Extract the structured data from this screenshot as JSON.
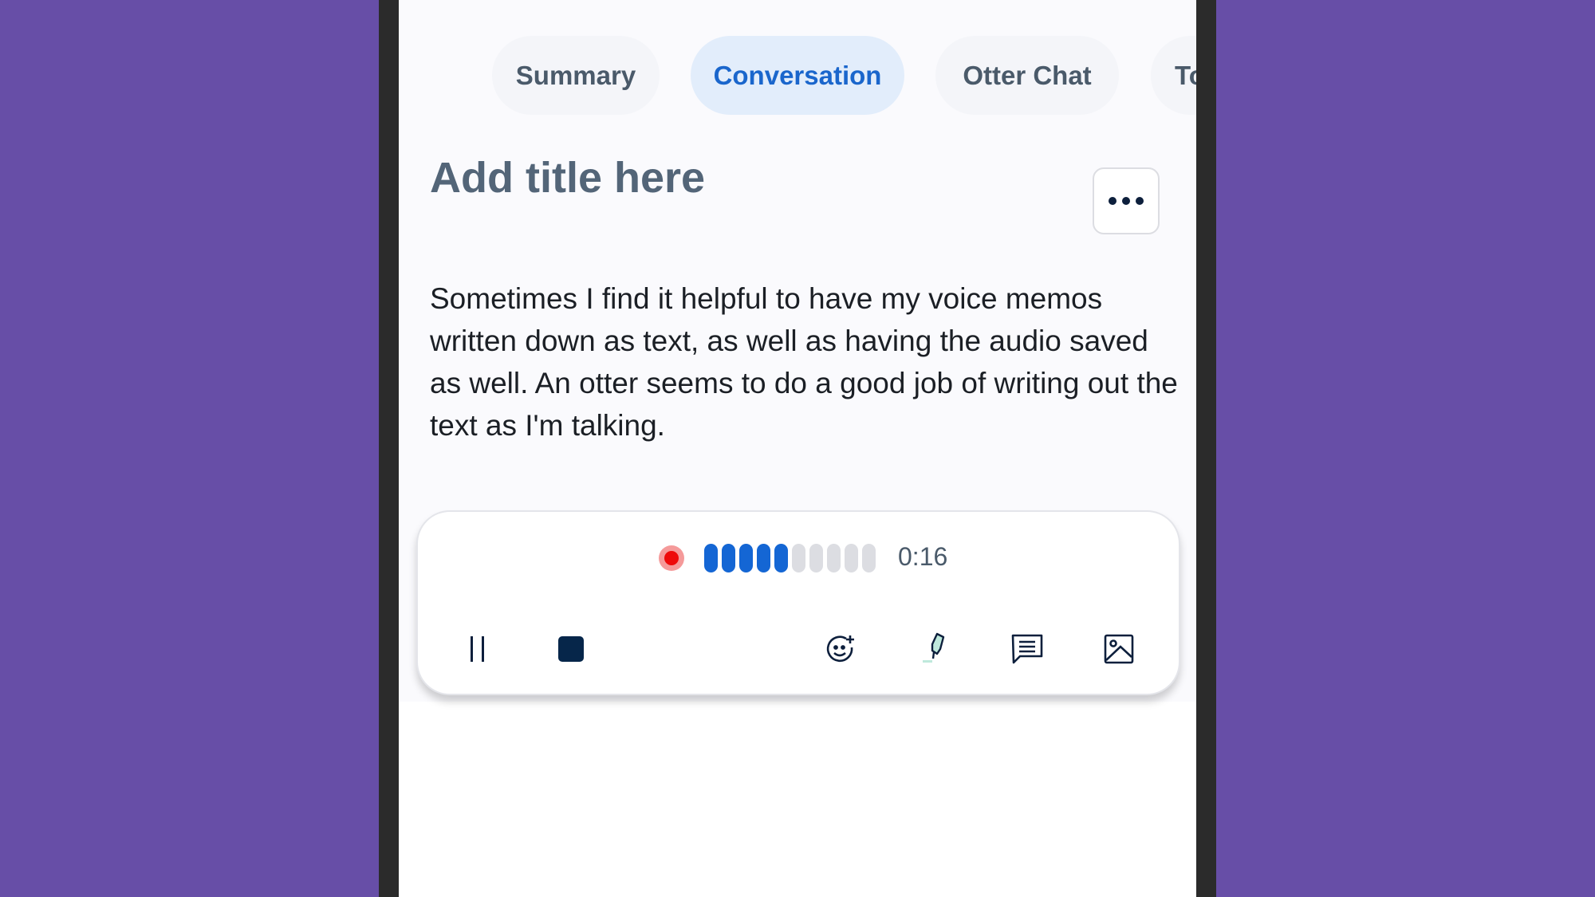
{
  "tabs": [
    {
      "label": "Summary",
      "active": false
    },
    {
      "label": "Conversation",
      "active": true
    },
    {
      "label": "Otter Chat",
      "active": false
    },
    {
      "label": "To",
      "active": false
    }
  ],
  "title_placeholder": "Add title here",
  "transcript": "Sometimes I find it helpful to have my voice memos written down as text, as well as having the audio saved as well. An otter seems to do a good job of writing out the text as I'm talking.",
  "recorder": {
    "status": "recording",
    "elapsed": "0:16",
    "level_bars_total": 10,
    "level_bars_active": 5,
    "colors": {
      "record": "#ee0a0a",
      "level_active": "#1466d4",
      "level_inactive": "#dcdde2",
      "accent": "#1a66cc"
    },
    "controls": [
      "pause-icon",
      "stop-icon",
      "add-emoji-icon",
      "highlight-icon",
      "comment-icon",
      "image-icon"
    ]
  }
}
